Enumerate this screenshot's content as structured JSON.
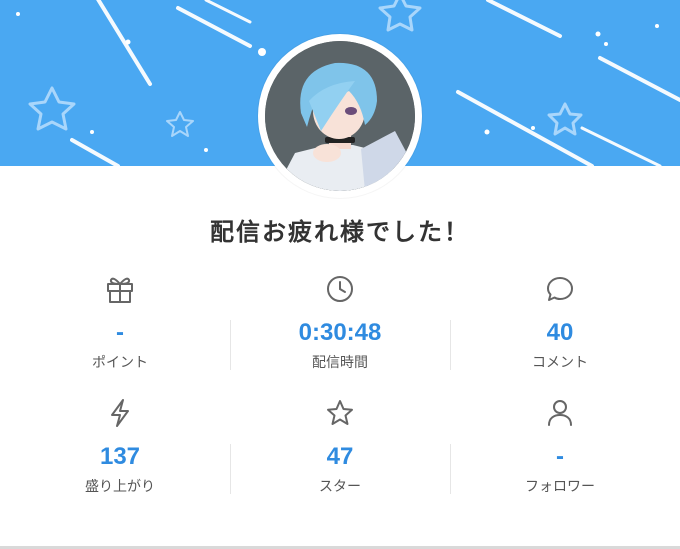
{
  "header": {
    "banner_color": "#4aa8f2"
  },
  "profile": {
    "avatar_icon": "streamer-avatar-illustration"
  },
  "summary": {
    "title": "配信お疲れ様でした！"
  },
  "stats": [
    {
      "icon": "gift-icon",
      "value": "-",
      "label": "ポイント"
    },
    {
      "icon": "clock-icon",
      "value": "0:30:48",
      "label": "配信時間"
    },
    {
      "icon": "comment-icon",
      "value": "40",
      "label": "コメント"
    },
    {
      "icon": "lightning-icon",
      "value": "137",
      "label": "盛り上がり"
    },
    {
      "icon": "star-icon",
      "value": "47",
      "label": "スター"
    },
    {
      "icon": "person-icon",
      "value": "-",
      "label": "フォロワー"
    }
  ],
  "colors": {
    "value_color": "#2f8be0",
    "label_color": "#555555",
    "icon_color": "#666666"
  }
}
